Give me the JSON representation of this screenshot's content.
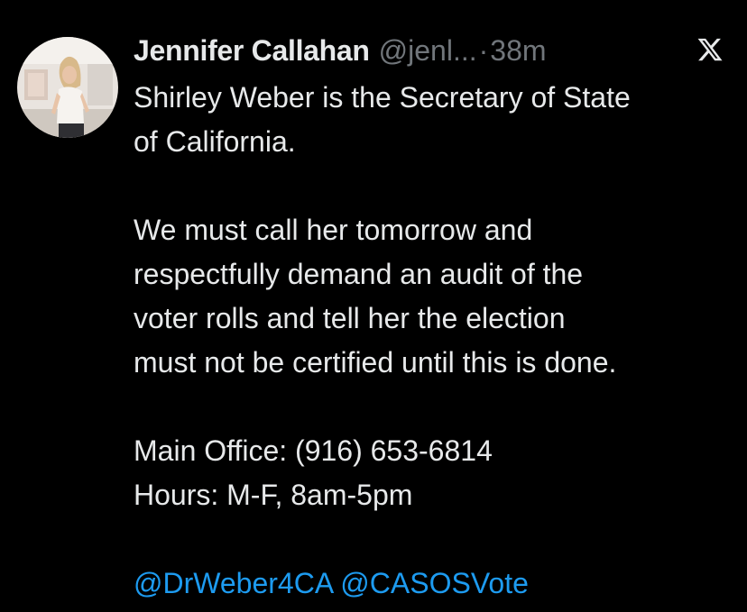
{
  "tweet": {
    "author_name": "Jennifer Callahan",
    "handle": "@jenl...",
    "separator": "·",
    "time": "38m",
    "platform_icon": "x-logo-icon",
    "avatar_icon": "profile-photo-avatar",
    "body_lines": [
      "Shirley Weber is the Secretary of State",
      "of California.",
      "We must call her tomorrow and",
      "respectfully demand an audit of the",
      "voter rolls and tell her the election",
      "must not be certified until this is done.",
      "Main Office: (916) 653-6814",
      "Hours: M-F, 8am-5pm"
    ],
    "mentions": [
      "@DrWeber4CA",
      "@CASOSVote"
    ]
  },
  "colors": {
    "background": "#000000",
    "text": "#e7e9ea",
    "secondary_text": "#71767b",
    "link": "#1d9bf0"
  }
}
